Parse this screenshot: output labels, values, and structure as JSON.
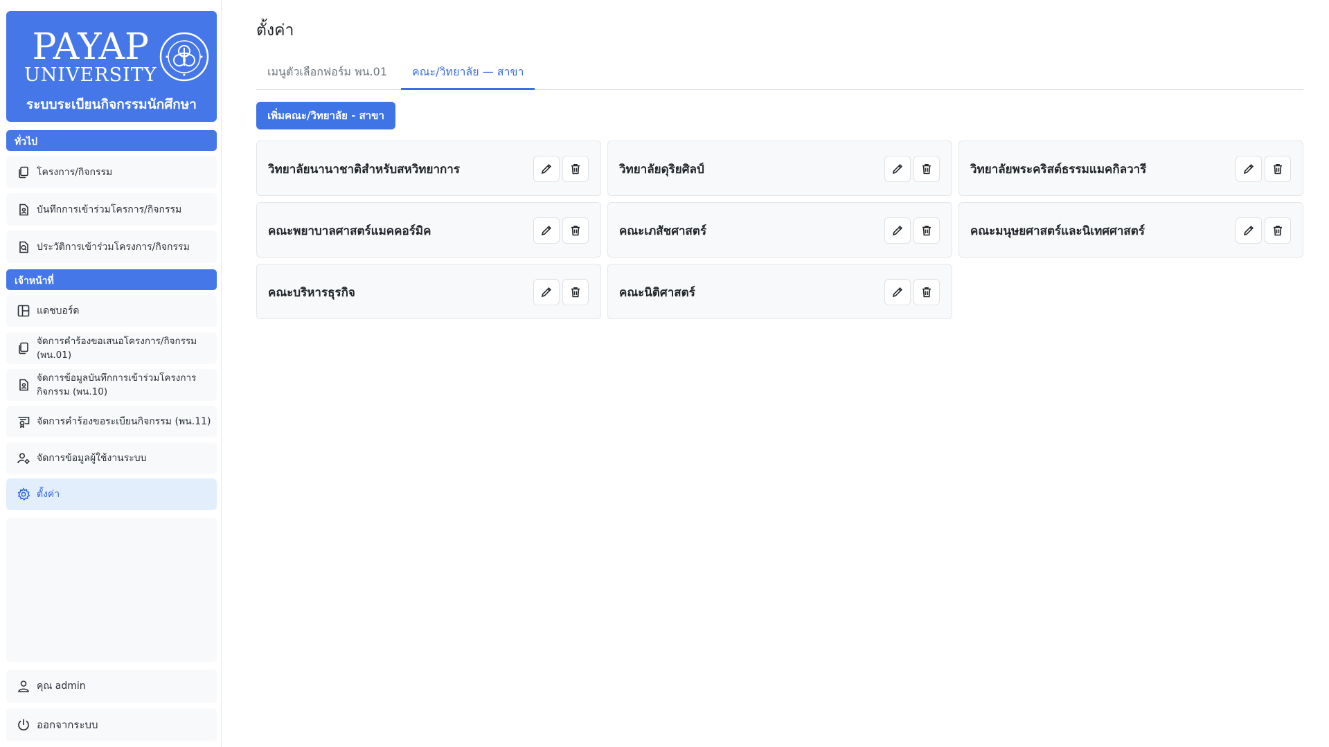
{
  "brand": {
    "logo_line1": "PAYAP",
    "logo_line2": "UNIVERSITY",
    "system_name": "ระบบระเบียนกิจกรรมนักศึกษา"
  },
  "sidebar": {
    "section_general": "ทั่วไป",
    "general_items": [
      {
        "label": "โครงการ/กิจกรรม",
        "icon": "documents-icon"
      },
      {
        "label": "บันทึกการเข้าร่วมโครการ/กิจกรรม",
        "icon": "document-person-icon"
      },
      {
        "label": "ประวัติการเข้าร่วมโครงการ/กิจกรรม",
        "icon": "document-search-icon"
      }
    ],
    "section_staff": "เจ้าหน้าที่",
    "staff_items": [
      {
        "label": "แดชบอร์ด",
        "icon": "dashboard-icon"
      },
      {
        "label": "จัดการคำร้องขอเสนอโครงการ/กิจกรรม (พน.01)",
        "icon": "documents-icon"
      },
      {
        "label": "จัดการข้อมูลบันทึกการเข้าร่วมโครงการ กิจกรรม (พน.10)",
        "icon": "document-person-icon"
      },
      {
        "label": "จัดการคำร้องขอระเบียนกิจกรรม (พน.11)",
        "icon": "certificate-icon"
      },
      {
        "label": "จัดการข้อมูลผู้ใช้งานระบบ",
        "icon": "user-gear-icon"
      },
      {
        "label": "ตั้งค่า",
        "icon": "gear-icon",
        "active": true
      }
    ],
    "user_label": "คุณ admin",
    "logout_label": "ออกจากระบบ"
  },
  "main": {
    "title": "ตั้งค่า",
    "tabs": [
      {
        "label": "เมนูตัวเลือกฟอร์ม พน.01",
        "active": false
      },
      {
        "label": "คณะ/วิทยาลัย — สาขา",
        "active": true
      }
    ],
    "add_button": "เพิ่มคณะ/วิทยาลัย - สาขา",
    "faculties": [
      "วิทยาลัยนานาชาติสำหรับสหวิทยาการ",
      "วิทยาลัยดุริยศิลป์",
      "วิทยาลัยพระคริสต์ธรรมแมคกิลวารี",
      "คณะพยาบาลศาสตร์แมคคอร์มิค",
      "คณะเภสัชศาสตร์",
      "คณะมนุษยศาสตร์และนิเทศศาสตร์",
      "คณะบริหารธุรกิจ",
      "คณะนิติศาสตร์"
    ]
  },
  "colors": {
    "accent": "#4577e8",
    "active_bg": "#e2eefc",
    "active_text": "#3066d8"
  }
}
